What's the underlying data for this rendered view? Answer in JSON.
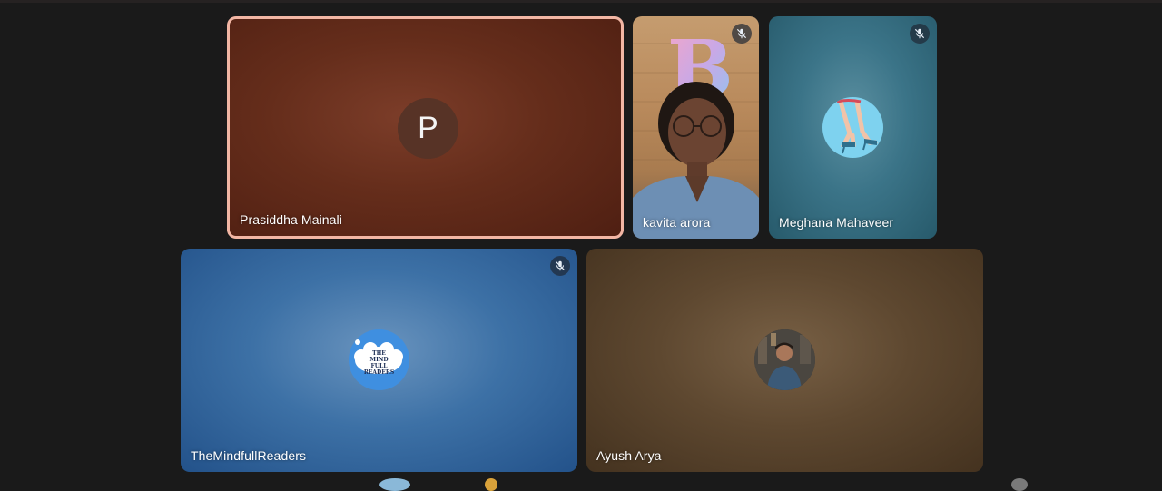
{
  "participants": [
    {
      "name": "Prasiddha Mainali",
      "avatar_letter": "P",
      "speaking": true,
      "muted": false
    },
    {
      "name": "kavita arora",
      "muted": true,
      "video": true
    },
    {
      "name": "Meghana Mahaveer",
      "muted": true
    },
    {
      "name": "TheMindfullReaders",
      "muted": true,
      "avatar_text": "THE MIND FULL READERS"
    },
    {
      "name": "Ayush Arya",
      "muted": false
    }
  ],
  "colors": {
    "speaking_border": "#f2b6a4",
    "background": "#1a1a1a"
  },
  "icons": {
    "mute": "mic-off-icon"
  }
}
